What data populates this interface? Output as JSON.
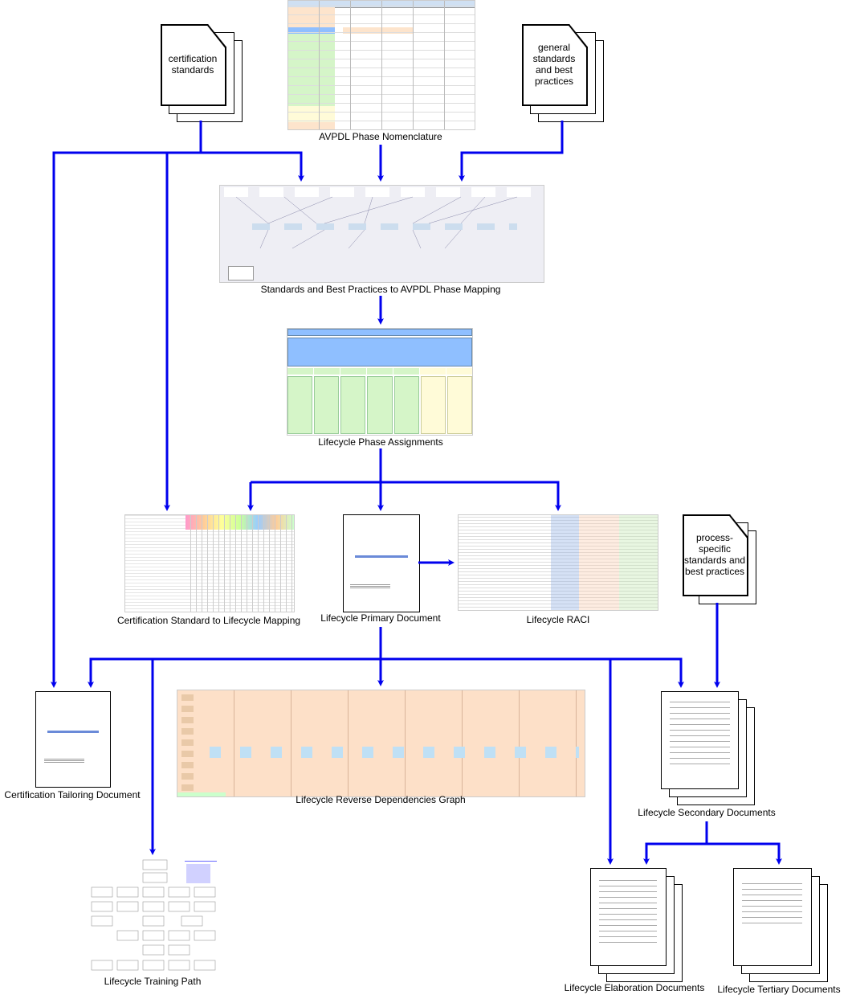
{
  "nodes": {
    "certification_standards": "certification standards",
    "general_standards": "general standards and best practices",
    "process_specific_standards": "process-specific standards and best practices",
    "avpdl_phase_nomenclature": "AVPDL Phase Nomenclature",
    "standards_mapping": "Standards and Best Practices to AVPDL Phase Mapping",
    "lifecycle_phase_assignments": "Lifecycle Phase Assignments",
    "cert_standard_mapping": "Certification Standard to Lifecycle Mapping",
    "lifecycle_primary_document": "Lifecycle Primary Document",
    "lifecycle_raci": "Lifecycle RACI",
    "certification_tailoring_document": "Certification Tailoring Document",
    "lifecycle_reverse_dependencies_graph": "Lifecycle Reverse Dependencies Graph",
    "lifecycle_secondary_documents": "Lifecycle Secondary Documents",
    "lifecycle_training_path": "Lifecycle Training Path",
    "lifecycle_elaboration_documents": "Lifecycle Elaboration Documents",
    "lifecycle_tertiary_documents": "Lifecycle Tertiary Documents"
  },
  "colors": {
    "arrow": "#0000ee",
    "phase_blue": "#8fbfff",
    "phase_green": "#d5f5c8",
    "phase_yellow": "#fffbd8",
    "phase_orange": "#fde4cc"
  }
}
